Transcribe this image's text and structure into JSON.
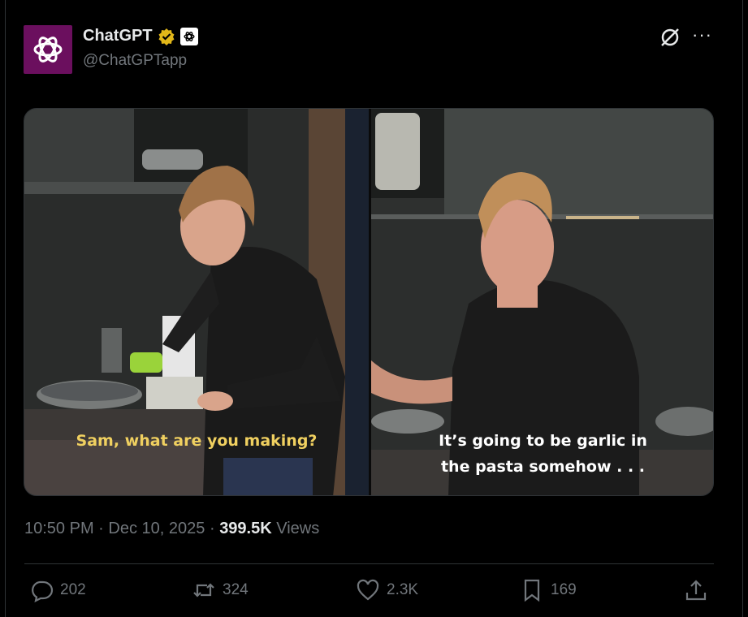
{
  "author": {
    "display_name": "ChatGPT",
    "handle": "@ChatGPTapp"
  },
  "media": {
    "left_caption": "Sam, what are you making?",
    "right_caption_line1": "It’s going to be garlic in",
    "right_caption_line2": "the pasta somehow . . ."
  },
  "meta": {
    "time": "10:50 PM",
    "date": "Dec 10, 2025",
    "views_count": "399.5K",
    "views_label": "Views",
    "dot": "·"
  },
  "actions": {
    "replies": "202",
    "reposts": "324",
    "likes": "2.3K",
    "bookmarks": "169"
  },
  "icons": {
    "avatar": "openai-logo-icon",
    "verified": "verified-badge-icon",
    "affiliation": "openai-affiliation-icon",
    "grok": "grok-icon",
    "more": "more-icon"
  },
  "colors": {
    "avatar_bg": "#6b0f5e",
    "verified": "#e2b719",
    "caption_yellow": "#f0d060"
  }
}
